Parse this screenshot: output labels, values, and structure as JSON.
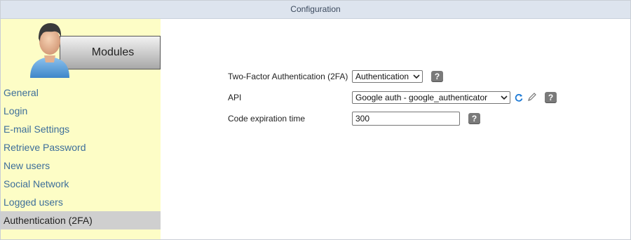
{
  "window": {
    "title": "Configuration"
  },
  "sidebar": {
    "header_label": "Modules",
    "items": [
      {
        "label": "General",
        "active": false
      },
      {
        "label": "Login",
        "active": false
      },
      {
        "label": "E-mail Settings",
        "active": false
      },
      {
        "label": "Retrieve Password",
        "active": false
      },
      {
        "label": "New users",
        "active": false
      },
      {
        "label": "Social Network",
        "active": false
      },
      {
        "label": "Logged users",
        "active": false
      },
      {
        "label": "Authentication (2FA)",
        "active": true
      }
    ]
  },
  "form": {
    "two_factor": {
      "label": "Two-Factor Authentication (2FA)",
      "value": "Authentication"
    },
    "api": {
      "label": "API",
      "value": "Google auth - google_authenticator"
    },
    "code_expiration": {
      "label": "Code expiration time",
      "value": "300"
    },
    "help_glyph": "?"
  },
  "colors": {
    "titlebar": "#dde4ee",
    "sidebar_bg": "#fdfdc6",
    "nav_link": "#3d6e9a",
    "active_item_bg": "#cfcfcf",
    "refresh_icon": "#1e7bd6"
  },
  "icons": [
    "user-avatar-icon",
    "chevron-down-icon",
    "refresh-icon",
    "pencil-icon",
    "help-icon"
  ]
}
